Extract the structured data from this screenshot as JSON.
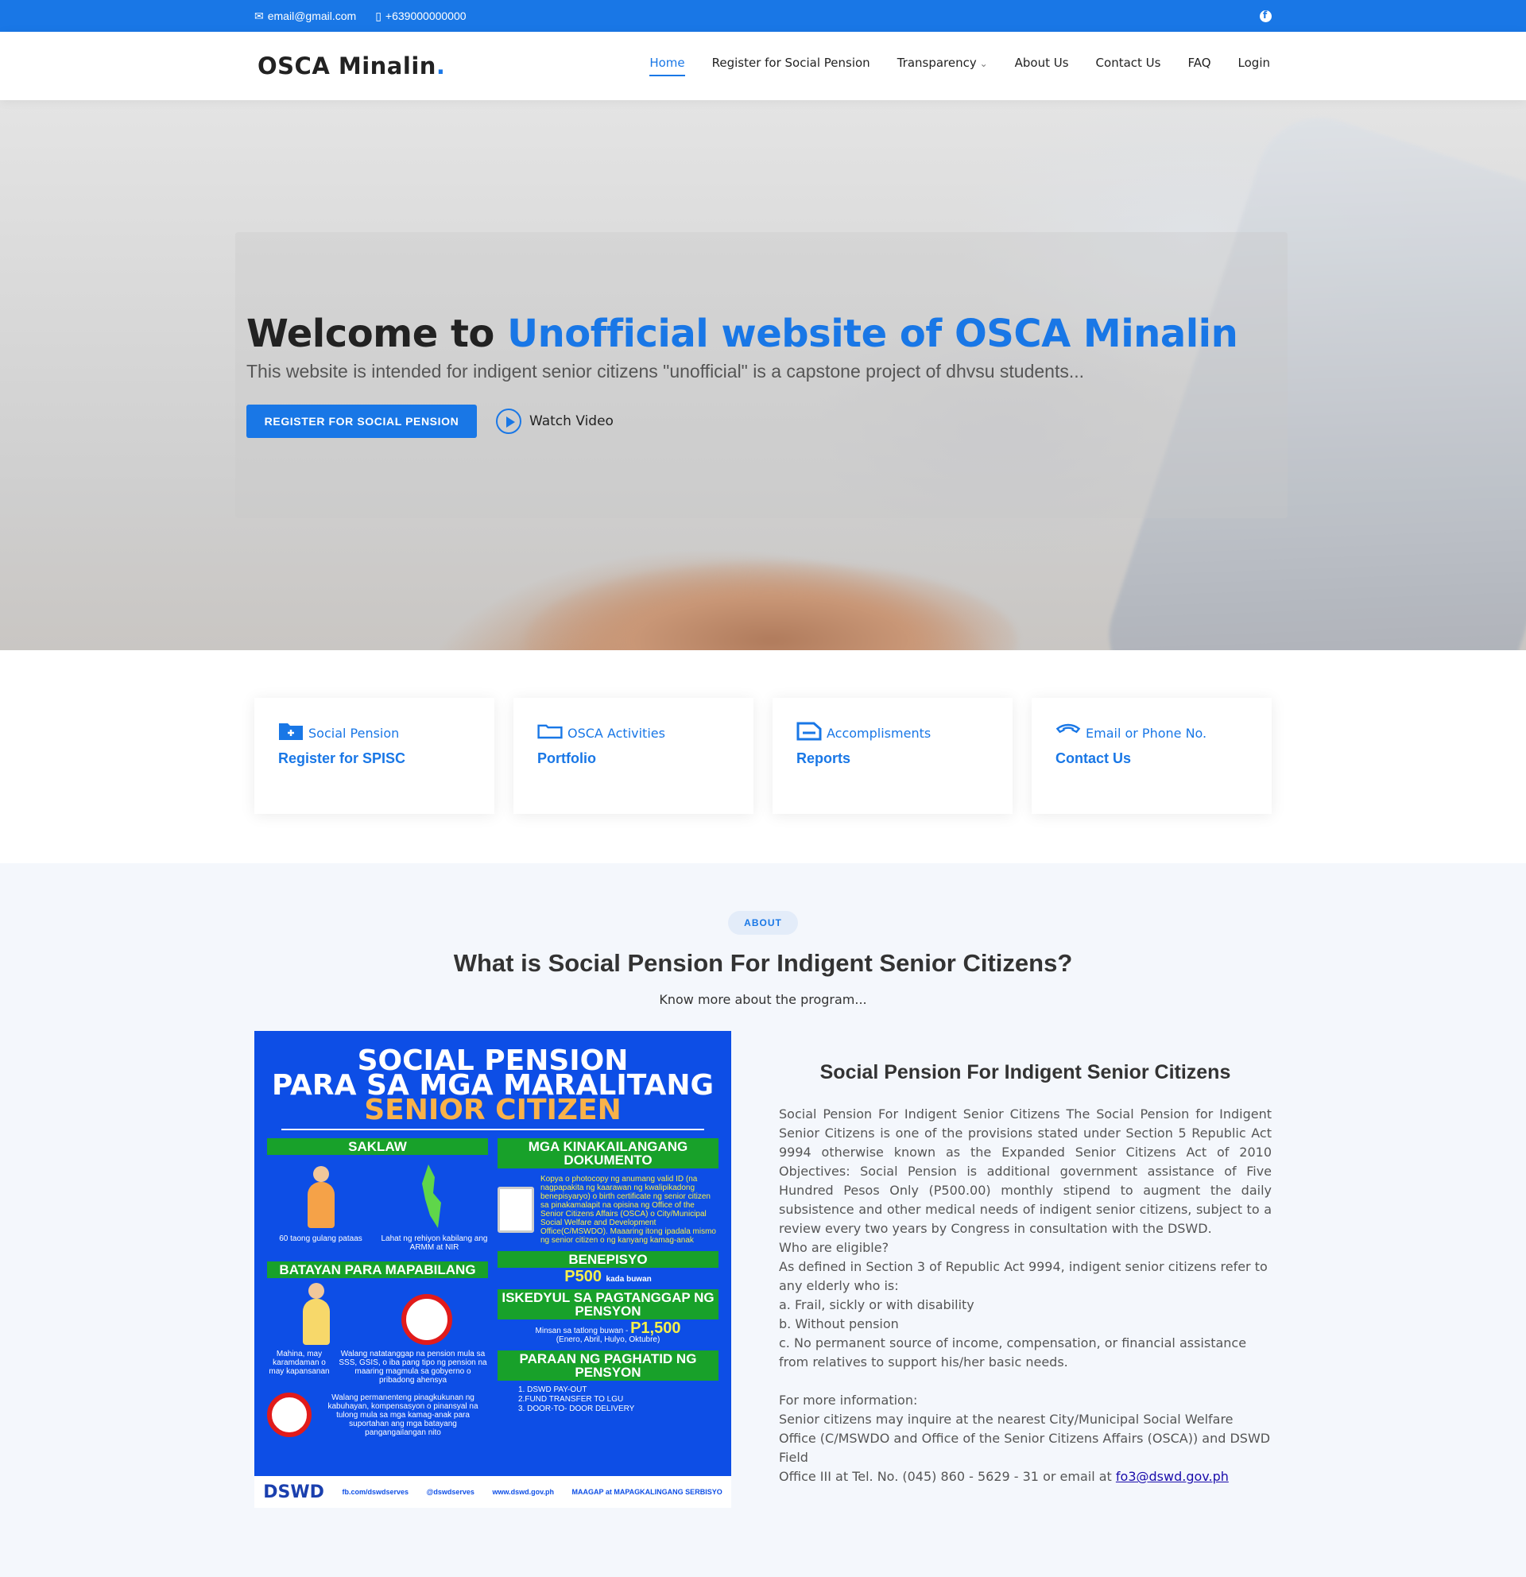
{
  "topbar": {
    "email": "email@gmail.com",
    "phone": "+639000000000",
    "social_icon": "facebook-icon"
  },
  "header": {
    "logo": "OSCA Minalin",
    "logo_dot": ".",
    "nav": [
      {
        "label": "Home",
        "active": true
      },
      {
        "label": "Register for Social Pension"
      },
      {
        "label": "Transparency",
        "dropdown": true
      },
      {
        "label": "About Us"
      },
      {
        "label": "Contact Us"
      },
      {
        "label": "FAQ"
      },
      {
        "label": "Login"
      }
    ]
  },
  "hero": {
    "title_prefix": "Welcome to ",
    "title_accent": "Unofficial website of OSCA Minalin",
    "subtitle": "This website is intended for indigent senior citizens \"unofficial\" is a capstone project of dhvsu students...",
    "primary_button": "REGISTER FOR SOCIAL PENSION",
    "watch_video": "Watch Video"
  },
  "features": [
    {
      "icon": "pension-folder-icon",
      "label": "Social Pension",
      "title": "Register for SPISC"
    },
    {
      "icon": "folder-icon",
      "label": "OSCA Activities",
      "title": "Portfolio"
    },
    {
      "icon": "report-icon",
      "label": "Accomplisments",
      "title": "Reports"
    },
    {
      "icon": "phone-icon",
      "label": "Email or Phone No.",
      "title": "Contact Us"
    }
  ],
  "about": {
    "badge": "ABOUT",
    "heading": "What is Social Pension For Indigent Senior Citizens?",
    "subheading": "Know more about the program...",
    "poster": {
      "title1": "SOCIAL PENSION",
      "title2": "PARA SA MGA MARALITANG",
      "title3": "SENIOR CITIZEN",
      "saklaw": "SAKLAW",
      "saklaw_a": "60 taong gulang pataas",
      "saklaw_b": "Lahat ng rehiyon kabilang ang ARMM at NIR",
      "batayan": "BATAYAN PARA MAPABILANG",
      "batayan_a": "Mahina, may karamdaman o may kapansanan",
      "batayan_b": "Walang natatanggap na pension mula sa SSS, GSIS, o iba pang tipo ng pension na maaring magmula sa gobyerno o pribadong ahensya",
      "batayan_c": "Walang permanenteng pinagkukunan ng kabuhayan, kompensasyon o pinansyal na tulong mula sa mga kamag-anak para suportahan ang mga batayang pangangailangan nito",
      "dokumento": "MGA KINAKAILANGANG DOKUMENTO",
      "dokumento_text": "Kopya o photocopy ng anumang valid ID (na nagpapakita ng kaarawan ng kwalipikadong benepisyaryo) o birth certificate ng senior citizen sa pinakamalapit na opisina ng Office of the Senior Citizens Affairs (OSCA) o City/Municipal Social Welfare and Development Office(C/MSWDO). Maaaring itong ipadala mismo ng senior citizen o ng kanyang kamag-anak",
      "benepisyo": "BENEPISYO",
      "benepisyo_amount": "P500",
      "benepisyo_unit": "kada buwan",
      "iskedyul": "ISKEDYUL SA PAGTANGGAP NG PENSYON",
      "iskedyul_text": "Minsan sa tatlong buwan -",
      "iskedyul_amount": "P1,500",
      "iskedyul_months": "(Enero, Abril, Hulyo, Oktubre)",
      "paraan": "PARAAN NG PAGHATID NG PENSYON",
      "paraan_1": "1. DSWD PAY-OUT",
      "paraan_2": "2.FUND TRANSFER TO LGU",
      "paraan_3": "3. DOOR-TO- DOOR DELIVERY",
      "footer_dswd": "DSWD",
      "footer_fb": "fb.com/dswdserves",
      "footer_tw": "@dswdserves",
      "footer_web": "www.dswd.gov.ph",
      "footer_maagap": "MAAGAP at MAPAGKALINGANG SERBISYO"
    },
    "text_title": "Social Pension For Indigent Senior Citizens",
    "paragraph": "Social Pension For Indigent Senior Citizens The Social Pension for Indigent Senior Citizens is one of the provisions stated under Section 5 Republic Act 9994 otherwise known as the Expanded Senior Citizens Act of 2010 Objectives: Social Pension is additional government assistance of Five Hundred Pesos Only (P500.00) monthly stipend to augment the daily subsistence and other medical needs of indigent senior citizens, subject to a review every two years by Congress in consultation with the DSWD.",
    "eligible_q": "Who are eligible?",
    "eligible_def": "As defined in Section 3 of Republic Act 9994, indigent senior citizens refer to any elderly who is:",
    "eligible_a": "a. Frail, sickly or with disability",
    "eligible_b": "b. Without pension",
    "eligible_c": "c. No permanent source of income, compensation, or financial assistance from relatives to support his/her basic needs.",
    "more_info": "For more information:",
    "inquire_1": "Senior citizens may inquire at the nearest City/Municipal Social Welfare",
    "inquire_2": "Office (C/MSWDO and Office of the Senior Citizens Affairs (OSCA)) and DSWD Field",
    "inquire_3": "Office III at Tel. No. (045) 860 - 5629 - 31 or email at ",
    "email_link": "fo3@dswd.gov.ph"
  },
  "colors": {
    "brand": "#1977e6",
    "poster_bg": "#0d4ee6",
    "poster_green": "#18a12a",
    "poster_orange": "#f9b24a"
  }
}
